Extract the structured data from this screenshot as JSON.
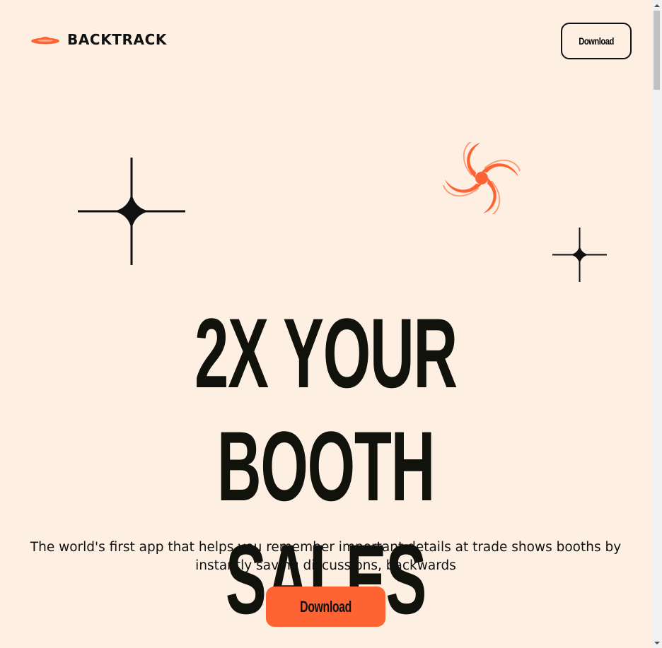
{
  "brand": {
    "name": "BACKTRACK",
    "logo_icon": "ufo-icon",
    "accent_color": "#fe6433"
  },
  "header": {
    "download_label": "Download"
  },
  "hero": {
    "headline_line1": "2X YOUR",
    "headline_line2": "BOOTH SALES",
    "subtitle": "The world's first app that helps you remember important details at trade shows booths by instantly saving discussions, backwards",
    "cta_label": "Download"
  },
  "decorations": {
    "icons": [
      "sparkle-icon",
      "sparkle-icon",
      "swirl-icon"
    ]
  },
  "colors": {
    "background": "#fdf0e3",
    "text": "#12120c",
    "cta": "#fe6433"
  }
}
